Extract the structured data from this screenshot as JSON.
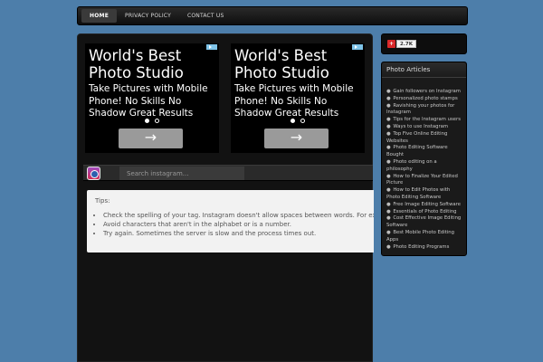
{
  "nav": {
    "items": [
      {
        "label": "HOME",
        "active": true
      },
      {
        "label": "PRIVACY POLICY",
        "active": false
      },
      {
        "label": "CONTACT US",
        "active": false
      }
    ]
  },
  "ads": [
    {
      "title": "World's Best Photo Studio",
      "text": "Take Pictures with Mobile Phone! No Skills No Shadow Great Results",
      "arrow": "→"
    },
    {
      "title": "World's Best Photo Studio",
      "text": "Take Pictures with Mobile Phone! No Skills No Shadow Great Results",
      "arrow": "→"
    }
  ],
  "search": {
    "placeholder": "Search instagram..."
  },
  "tips": {
    "title": "Tips:",
    "items": [
      "Check the spelling of your tag. Instagram doesn't allow spaces between words. For example \"Coca Cola\"",
      "Avoid characters that aren't in the alphabet or is a number.",
      "Try again. Sometimes the server is slow and the process times out."
    ]
  },
  "share": {
    "count": "2.7K"
  },
  "sidebar": {
    "title": "Photo Articles",
    "items": [
      "Gain followers on Instagram",
      "Personalized photo stamps",
      "Ravishing your photos for Instagram",
      "Tips for the Instagram users",
      "Ways to use Instagram",
      "Top Five Online Editing Websites",
      "Photo Editing Software Bought",
      "Photo editing on a philosophy",
      "How to Finalize Your Edited Picture",
      "How to Edit Photos with Photo Editing Software",
      "Free Image Editing Software",
      "Essentials of Photo Editing",
      "Cost Effective Image Editing Software",
      "Best Mobile Photo Editing Apps",
      "Photo Editing Programs"
    ]
  },
  "colors": {
    "background": "#4d7eaa",
    "panel": "#121212",
    "ad_button": "#9a9a9a",
    "share_red": "#d9282a"
  }
}
